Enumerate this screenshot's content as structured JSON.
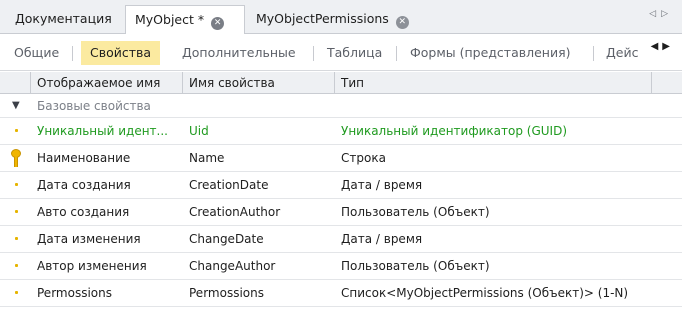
{
  "doc_tabs": [
    {
      "label": "Документация",
      "active": false,
      "closable": false
    },
    {
      "label": "MyObject *",
      "active": true,
      "closable": true
    },
    {
      "label": "MyObjectPermissions",
      "active": false,
      "closable": true
    }
  ],
  "section_tabs": [
    {
      "label": "Общие",
      "active": false
    },
    {
      "label": "Свойства",
      "active": true
    },
    {
      "label": "Дополнительные",
      "active": false
    },
    {
      "label": "Таблица",
      "active": false
    },
    {
      "label": "Формы (представления)",
      "active": false
    },
    {
      "label": "Дейс",
      "active": false
    }
  ],
  "columns": [
    {
      "label": "Отображаемое имя"
    },
    {
      "label": "Имя свойства"
    },
    {
      "label": "Тип"
    }
  ],
  "group": {
    "label": "Базовые свойства",
    "expanded": true
  },
  "rows": [
    {
      "display_name": "Уникальный идент...",
      "property": "Uid",
      "type": "Уникальный идентификатор (GUID)",
      "system": true,
      "icon": "dot-marker-icon"
    },
    {
      "display_name": "Наименование",
      "property": "Name",
      "type": "Строка",
      "system": false,
      "icon": "key-icon"
    },
    {
      "display_name": "Дата создания",
      "property": "CreationDate",
      "type": "Дата / время",
      "system": false,
      "icon": "dot-marker-icon"
    },
    {
      "display_name": "Авто создания",
      "property": "CreationAuthor",
      "type": "Пользователь (Объект)",
      "system": false,
      "icon": "dot-marker-icon"
    },
    {
      "display_name": "Дата изменения",
      "property": "ChangeDate",
      "type": "Дата / время",
      "system": false,
      "icon": "dot-marker-icon"
    },
    {
      "display_name": "Автор изменения",
      "property": "ChangeAuthor",
      "type": "Пользователь (Объект)",
      "system": false,
      "icon": "dot-marker-icon"
    },
    {
      "display_name": "Permossions",
      "property": "Permossions",
      "type": "Список<MyObjectPermissions (Объект)> (1-N)",
      "system": false,
      "icon": "dot-marker-icon"
    }
  ],
  "colors": {
    "system_text": "#1f9a1f",
    "active_section_tab": "#fbeaa0",
    "key": "#f0b500"
  }
}
